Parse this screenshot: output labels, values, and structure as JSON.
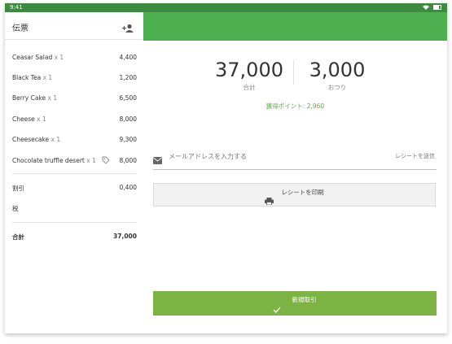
{
  "status_bar": {
    "time": "9:41"
  },
  "sidebar": {
    "title": "伝票",
    "items": [
      {
        "name": "Ceasar Salad",
        "qty": "x 1",
        "price": "4,400"
      },
      {
        "name": "Black Tea",
        "qty": "x 1",
        "price": "1,200"
      },
      {
        "name": "Berry Cake",
        "qty": "x 1",
        "price": "6,500"
      },
      {
        "name": "Cheese",
        "qty": "x 1",
        "price": "8,000"
      },
      {
        "name": "Cheesecake",
        "qty": "x 1",
        "price": "9,300"
      },
      {
        "name": "Chocolate truffle desert",
        "qty": "x 1",
        "price": "8,000"
      }
    ],
    "discount_label": "割引",
    "discount_value": "0,400",
    "tax_label": "税",
    "total_label": "合計",
    "total_value": "37,000"
  },
  "summary": {
    "total_amount": "37,000",
    "total_caption": "合計",
    "change_amount": "3,000",
    "change_caption": "おつり",
    "points_text": "獲得ポイント: 2,960"
  },
  "email": {
    "placeholder": "メールアドレスを入力する",
    "send_label": "レシートを送信"
  },
  "print_button_label": "レシートを印刷",
  "new_transaction_label": "新規取引",
  "colors": {
    "header_green": "#4caf50",
    "status_green": "#3d8b40",
    "button_green": "#7cb342",
    "points_green": "#6aa84f"
  }
}
